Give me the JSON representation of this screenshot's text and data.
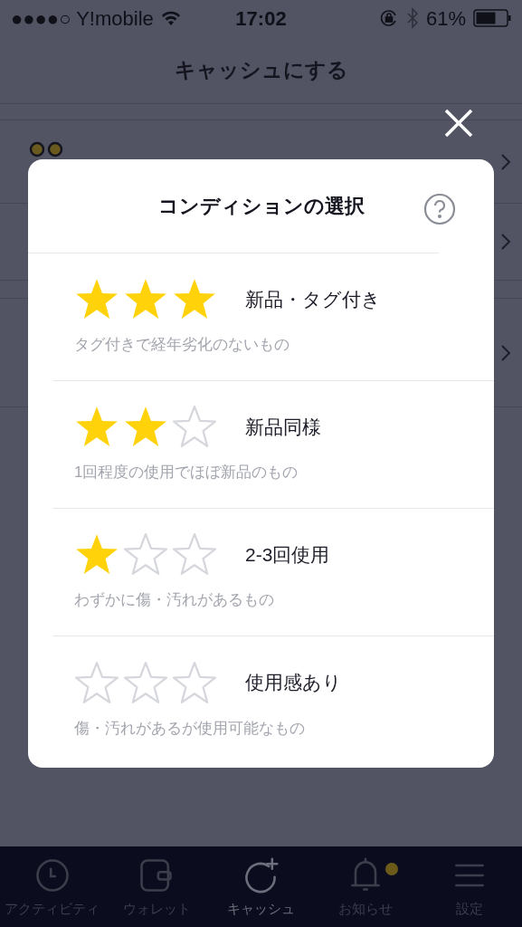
{
  "status_bar": {
    "carrier": "●●●●○ Y!mobile",
    "time": "17:02",
    "battery": "61%"
  },
  "header": {
    "title": "キャッシュにする"
  },
  "modal": {
    "title": "コンディションの選択",
    "conditions": [
      {
        "stars": 3,
        "label": "新品・タグ付き",
        "description": "タグ付きで経年劣化のないもの"
      },
      {
        "stars": 2,
        "label": "新品同様",
        "description": "1回程度の使用でほぼ新品のもの"
      },
      {
        "stars": 1,
        "label": "2-3回使用",
        "description": "わずかに傷・汚れがあるもの"
      },
      {
        "stars": 0,
        "label": "使用感あり",
        "description": "傷・汚れがあるが使用可能なもの"
      }
    ]
  },
  "tab_bar": [
    {
      "kind": "clock",
      "label": "アクティビティ",
      "selected": false,
      "badge": false
    },
    {
      "kind": "wallet",
      "label": "ウォレット",
      "selected": false,
      "badge": false
    },
    {
      "kind": "cash",
      "label": "キャッシュ",
      "selected": true,
      "badge": false
    },
    {
      "kind": "bell",
      "label": "お知らせ",
      "selected": false,
      "badge": true
    },
    {
      "kind": "menu",
      "label": "設定",
      "selected": false,
      "badge": false
    }
  ]
}
